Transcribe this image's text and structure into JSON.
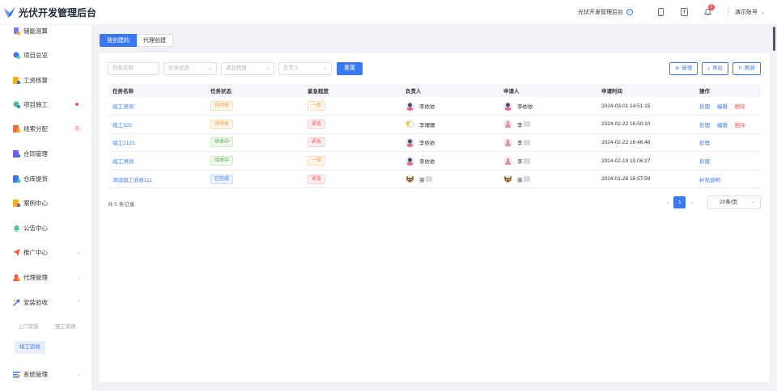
{
  "app": {
    "title": "光伏开发管理后台"
  },
  "header": {
    "site_name": "光伏开发管理后台",
    "notification_count": "3",
    "account": "演示账号"
  },
  "sidebar": {
    "items": [
      {
        "label": "储能测算",
        "icon": "storage-icon"
      },
      {
        "label": "项目总览",
        "icon": "overview-icon"
      },
      {
        "label": "工资核算",
        "icon": "payroll-icon"
      },
      {
        "label": "项目施工",
        "icon": "construction-icon"
      },
      {
        "label": "线索分配",
        "icon": "lead-icon",
        "badge": "1"
      },
      {
        "label": "合同管理",
        "icon": "contract-icon"
      },
      {
        "label": "仓库提货",
        "icon": "warehouse-icon"
      },
      {
        "label": "案例中心",
        "icon": "case-icon"
      },
      {
        "label": "公告中心",
        "icon": "bell-icon"
      },
      {
        "label": "推广中心",
        "icon": "send-icon"
      },
      {
        "label": "代理管理",
        "icon": "agent-icon"
      },
      {
        "label": "安装验收",
        "icon": "acceptance-icon"
      },
      {
        "label": "系统管理",
        "icon": "settings-icon"
      }
    ],
    "sub_items": [
      "上门安装",
      "施工验收",
      "竣工验收"
    ]
  },
  "tabs": [
    "我创建的",
    "代理创建"
  ],
  "filters": {
    "task_name": "任务名称",
    "task_status": "任务状态",
    "urgency": "紧急程度",
    "owner": "负责人",
    "reset": "重置"
  },
  "actions": {
    "add": "新增",
    "export": "导出",
    "refresh": "刷新"
  },
  "table": {
    "headers": [
      "任务名称",
      "任务状态",
      "紧急程度",
      "负责人",
      "申请人",
      "申请时间",
      "操作"
    ],
    "rows": [
      {
        "name": "竣工测测",
        "status": "待验收",
        "urgency": "一般",
        "owner": "李依依",
        "applicant": "李依依",
        "time": "2024-03-01 14:51:15",
        "ops": [
          "处理",
          "编辑",
          "删除"
        ]
      },
      {
        "name": "竣工323",
        "status": "待验收",
        "urgency": "紧急",
        "owner": "李珊珊",
        "applicant": "李",
        "time": "2024-02-22 16:50:10",
        "ops": [
          "处理",
          "编辑",
          "删除"
        ]
      },
      {
        "name": "竣工2121",
        "status": "验收中",
        "urgency": "紧急",
        "owner": "李依依",
        "applicant": "李",
        "time": "2024-02-22 16:46:48",
        "ops": [
          "处理"
        ]
      },
      {
        "name": "竣工测测",
        "status": "验收中",
        "urgency": "一般",
        "owner": "李依依",
        "applicant": "李",
        "time": "2024-02-19 15:06:27",
        "ops": [
          "处理"
        ]
      },
      {
        "name": "测试竣工验收111",
        "status": "已完成",
        "urgency": "紧急",
        "owner": "梁",
        "applicant": "梁",
        "time": "2024-01-26 16:57:58",
        "ops": [
          "补充说明"
        ]
      }
    ]
  },
  "pagination": {
    "total_text": "共 5 条记录",
    "current_page": "1",
    "page_size": "20条/页"
  },
  "colors": {
    "primary": "#3a78f2",
    "danger": "#f05a5a",
    "warning": "#f0a030",
    "success": "#4cae4c"
  }
}
